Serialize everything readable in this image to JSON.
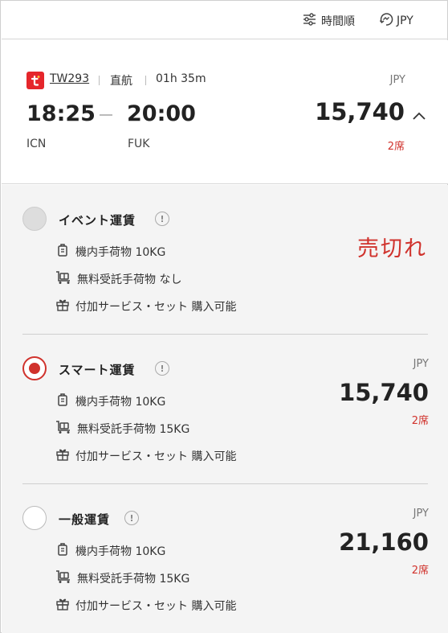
{
  "toolbar": {
    "sort_label": "時間順",
    "currency_label": "JPY"
  },
  "flight": {
    "flight_no": "TW293",
    "type": "直航",
    "duration": "01h 35m",
    "dep_time": "18:25",
    "arr_time": "20:00",
    "dep_code": "ICN",
    "arr_code": "FUK",
    "currency": "JPY",
    "price": "15,740",
    "seats": "2席"
  },
  "fares": [
    {
      "name": "イベント運賃",
      "status": "売切れ",
      "features": [
        "機内手荷物 10KG",
        "無料受託手荷物 なし",
        "付加サービス・セット 購入可能"
      ]
    },
    {
      "name": "スマート運賃",
      "currency": "JPY",
      "price": "15,740",
      "seats": "2席",
      "features": [
        "機内手荷物 10KG",
        "無料受託手荷物 15KG",
        "付加サービス・セット 購入可能"
      ]
    },
    {
      "name": "一般運賃",
      "currency": "JPY",
      "price": "21,160",
      "seats": "2席",
      "features": [
        "機内手荷物 10KG",
        "無料受託手荷物 15KG",
        "付加サービス・セット 購入可能"
      ]
    }
  ],
  "colors": {
    "accent": "#d0322c",
    "brand_logo": "#e5262b",
    "fare_background": "#f4f4f4"
  },
  "icons": {
    "sort": "sliders-icon",
    "currency": "currency-exchange-icon",
    "logo": "tway-logo-icon",
    "expand": "chevron-up-icon",
    "info": "info-icon",
    "carry_on": "carry-on-bag-icon",
    "checked_bag": "luggage-cart-icon",
    "service": "gift-icon"
  }
}
